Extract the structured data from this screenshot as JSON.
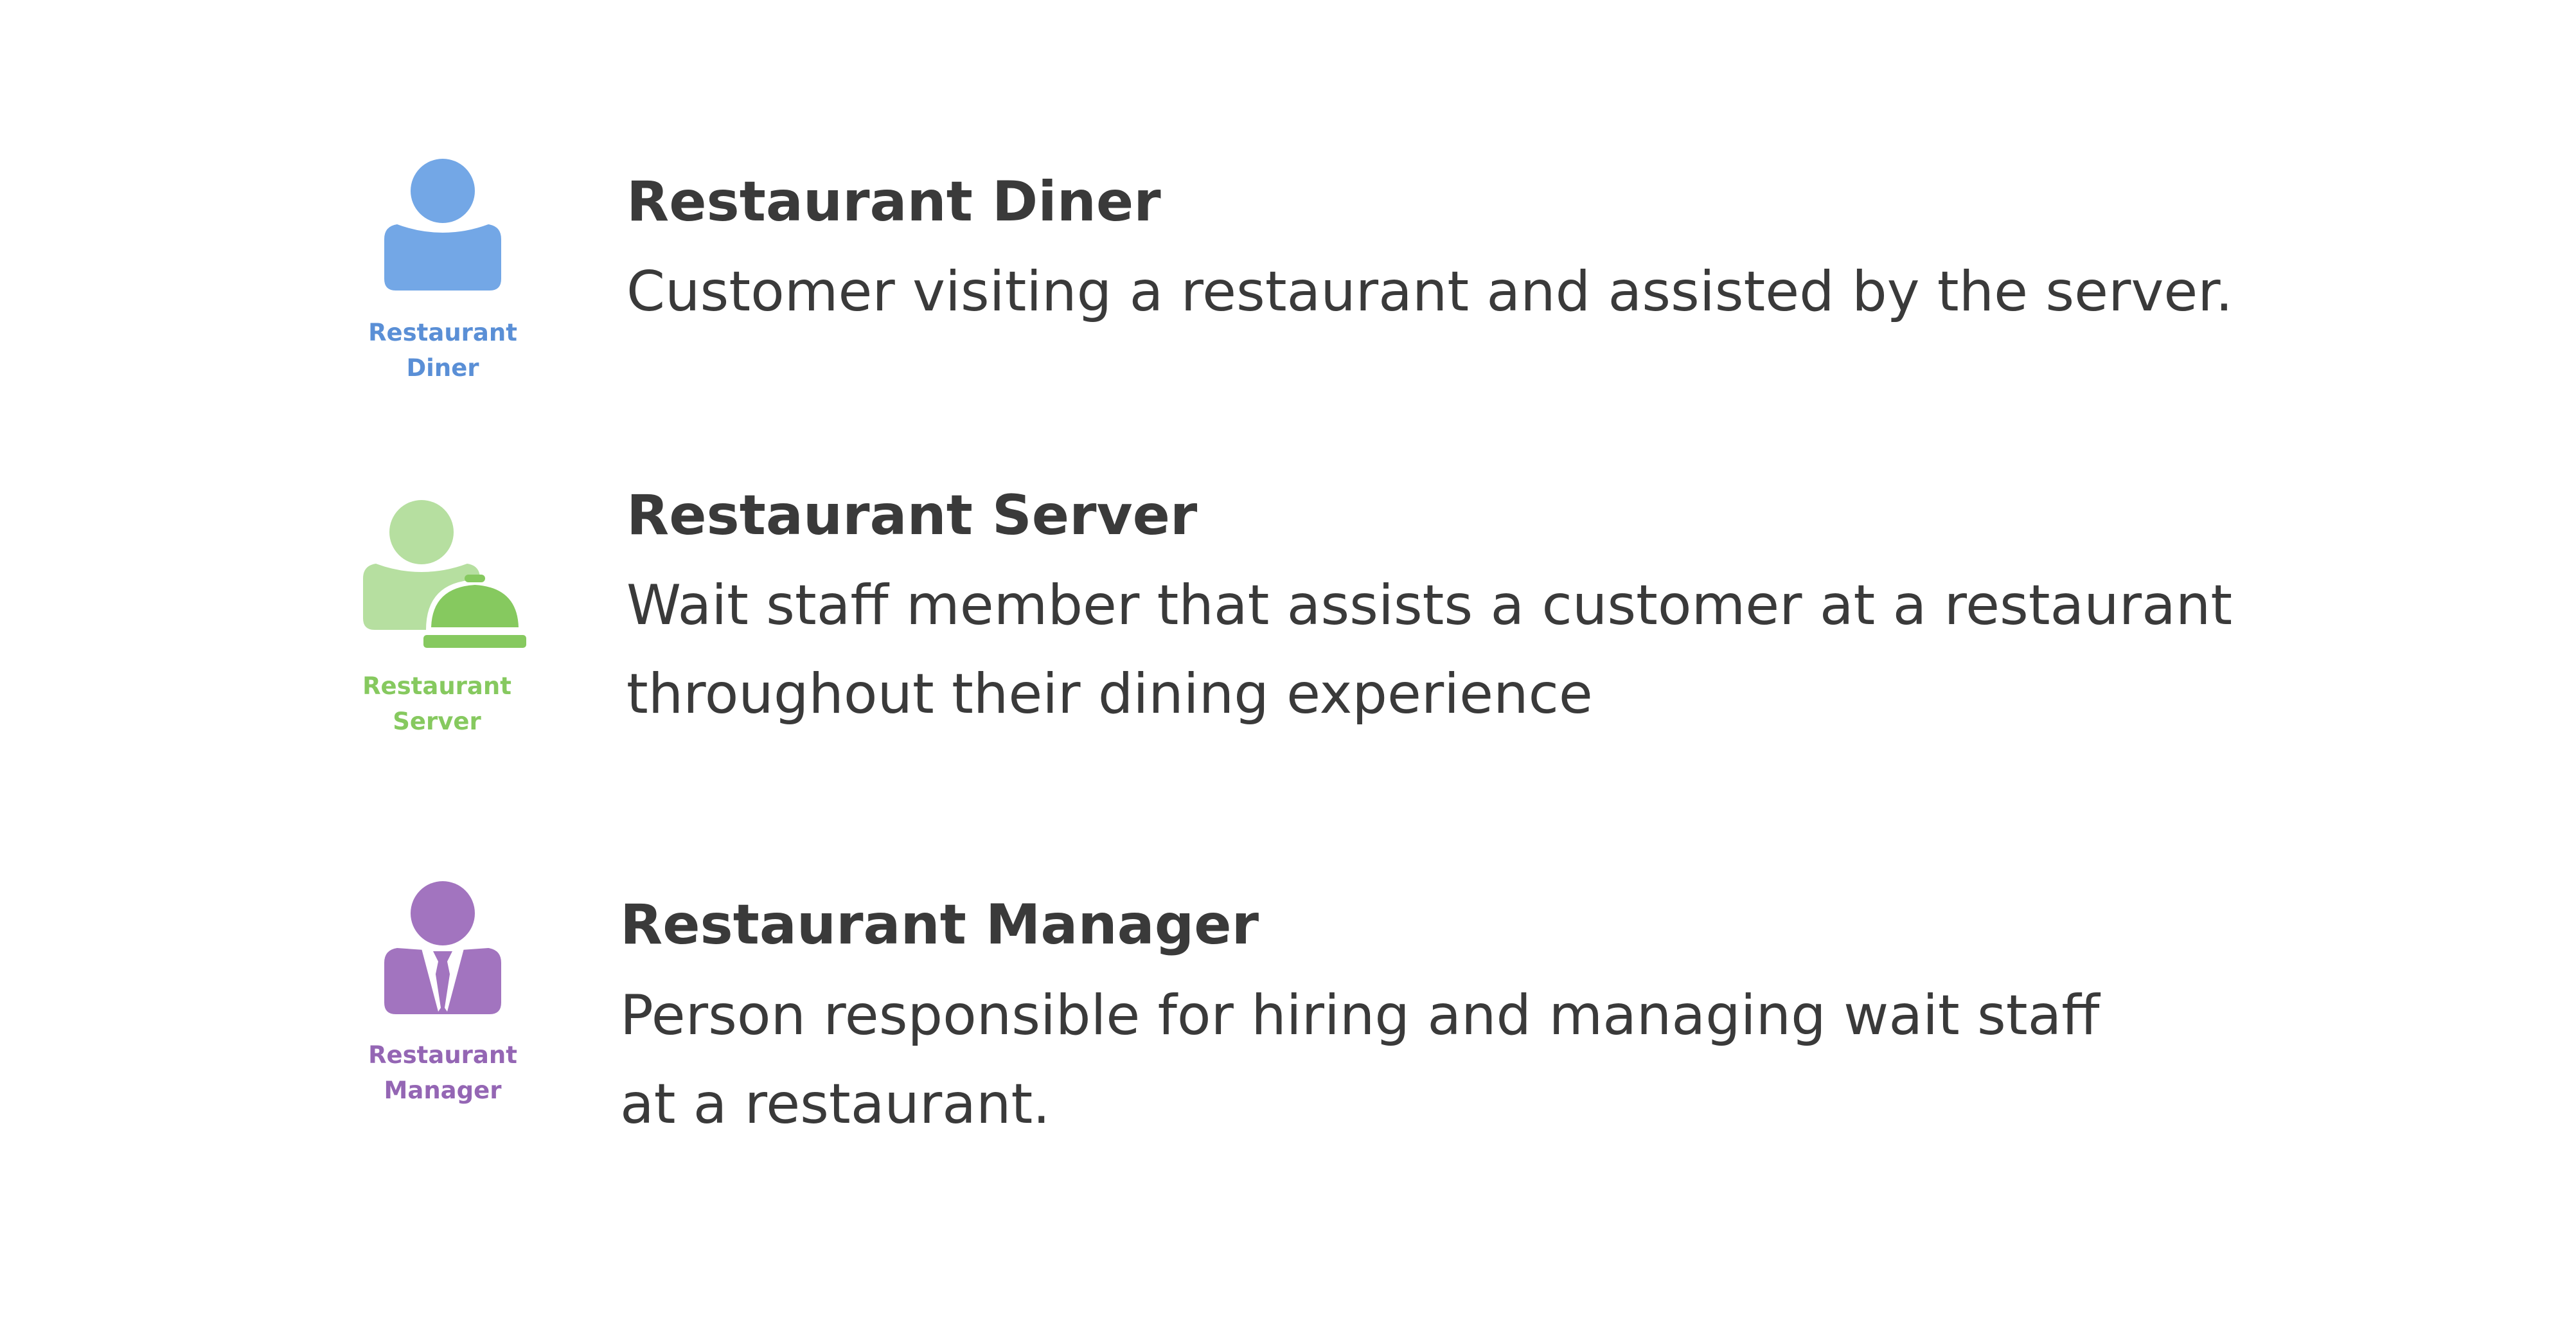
{
  "personas": [
    {
      "caption_line1": "Restaurant",
      "caption_line2": "Diner",
      "title": "Restaurant Diner",
      "desc_line1": "Customer visiting a restaurant and assisted by the server.",
      "desc_line2": "",
      "color": "#73a7e6",
      "icon": "person-icon"
    },
    {
      "caption_line1": "Restaurant",
      "caption_line2": "Server",
      "title": "Restaurant Server",
      "desc_line1": "Wait staff member that assists a customer at a restaurant",
      "desc_line2": "throughout their dining experience",
      "color": "#b6dfa0",
      "accent_color": "#86c95f",
      "icon": "server-with-cloche-icon"
    },
    {
      "caption_line1": "Restaurant",
      "caption_line2": "Manager",
      "title": "Restaurant Manager",
      "desc_line1": "Person responsible for hiring and managing wait staff",
      "desc_line2": "at a restaurant.",
      "color": "#a274bf",
      "icon": "manager-with-tie-icon"
    }
  ]
}
